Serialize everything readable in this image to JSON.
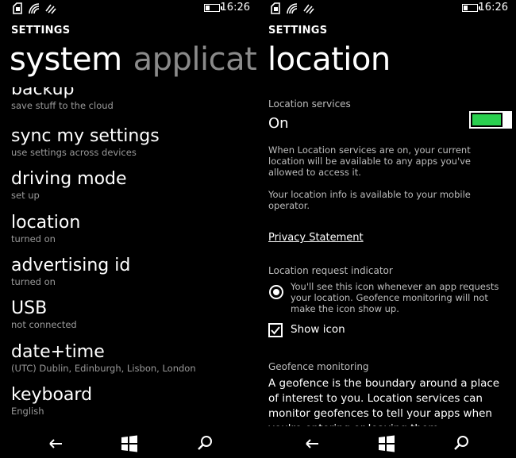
{
  "status": {
    "time": "16:26"
  },
  "left": {
    "app_title": "SETTINGS",
    "pivot_active": "system",
    "pivot_next": "applicati",
    "items": [
      {
        "title": "backup",
        "subtitle": "save stuff to the cloud"
      },
      {
        "title": "sync my settings",
        "subtitle": "use settings across devices"
      },
      {
        "title": "driving mode",
        "subtitle": "set up"
      },
      {
        "title": "location",
        "subtitle": "turned on"
      },
      {
        "title": "advertising id",
        "subtitle": "turned on"
      },
      {
        "title": "USB",
        "subtitle": "not connected"
      },
      {
        "title": "date+time",
        "subtitle": "(UTC) Dublin, Edinburgh, Lisbon, London"
      },
      {
        "title": "keyboard",
        "subtitle": "English"
      }
    ]
  },
  "right": {
    "app_title": "SETTINGS",
    "page_title": "location",
    "location_services_label": "Location services",
    "location_services_state": "On",
    "toggle_on": true,
    "desc1": "When Location services are on, your current location will be available to any apps you've allowed to access it.",
    "desc2": "Your location info is available to your mobile operator.",
    "privacy_link": "Privacy Statement",
    "request_indicator_label": "Location request indicator",
    "indicator_text": "You'll see this icon whenever an app requests your location. Geofence monitoring will not make the icon show up.",
    "show_icon_label": "Show icon",
    "show_icon_checked": true,
    "geofence_label": "Geofence monitoring",
    "geofence_text": "A geofence is the boundary around a place of interest to you. Location services can monitor geofences to tell your apps when you're entering or leaving them."
  },
  "colors": {
    "accent": "#2ad04f",
    "text_secondary": "#9a9a9a",
    "inactive_pivot": "#8a8a8a"
  }
}
